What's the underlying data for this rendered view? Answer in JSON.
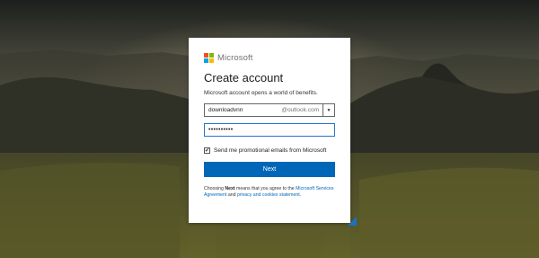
{
  "brand": {
    "name": "Microsoft",
    "logo_colors": [
      "#f25022",
      "#7fba00",
      "#00a4ef",
      "#ffb900"
    ]
  },
  "form": {
    "title": "Create account",
    "subtitle": "Microsoft account opens a world of benefits.",
    "email_username": "downloadvnn",
    "email_domain": "@outlook.com",
    "domain_dropdown_icon": "caret-down",
    "password_value": "••••••••••",
    "promo_checked": true,
    "promo_label": "Send me promotional emails from Microsoft",
    "next_label": "Next",
    "terms": {
      "prefix": "Choosing ",
      "bold": "Next",
      "middle": " means that you agree to the ",
      "link1": "Microsoft Services Agreement",
      "and": " and ",
      "link2": "privacy and cookies statement",
      "suffix": "."
    }
  },
  "colors": {
    "accent": "#0067b8",
    "focus_border": "#2a72c9"
  }
}
